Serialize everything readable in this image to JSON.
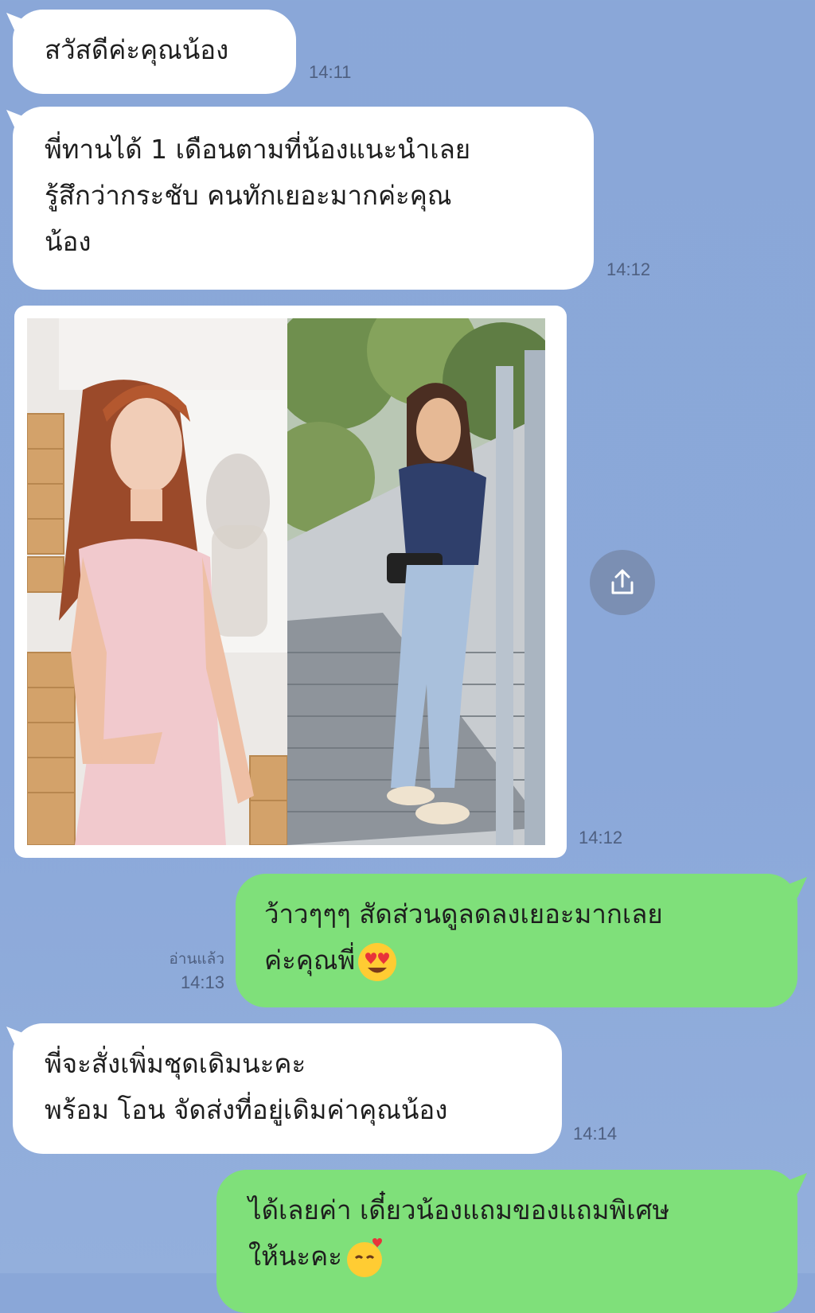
{
  "messages": [
    {
      "id": "m1",
      "side": "in",
      "lines": [
        "สวัสดีค่ะคุณน้อง"
      ],
      "time": "14:11"
    },
    {
      "id": "m2",
      "side": "in",
      "lines": [
        "พี่ทานได้ 1 เดือนตามที่น้องแนะนำเลย",
        "รู้สึกว่ากระชับ คนทักเยอะมากค่ะคุณ",
        "น้อง"
      ],
      "time": "14:12"
    },
    {
      "id": "m3",
      "side": "in",
      "type": "image",
      "time": "14:12"
    },
    {
      "id": "m4",
      "side": "out",
      "lines": [
        "ว้าวๆๆๆ สัดส่วนดูลดลงเยอะมากเลย",
        "ค่ะคุณพี่"
      ],
      "emoji": "heart-eyes-emoji",
      "read_label": "อ่านแล้ว",
      "time": "14:13"
    },
    {
      "id": "m5",
      "side": "in",
      "lines": [
        "พี่จะสั่งเพิ่มชุดเดิมนะคะ",
        "พร้อม โอน จัดส่งที่อยู่เดิมค่าคุณน้อง"
      ],
      "time": "14:14"
    },
    {
      "id": "m6",
      "side": "out",
      "lines": [
        "ได้เลยค่า เดี๋ยวน้องแถมของแถมพิเศษ",
        "ให้นะคะ"
      ],
      "emoji": "smiling-hearts-emoji"
    }
  ],
  "icons": {
    "share": "share-icon"
  },
  "colors": {
    "background": "#8ba8d9",
    "incoming_bubble": "#ffffff",
    "outgoing_bubble": "#7fe07a",
    "timestamp": "#4e5f80"
  }
}
